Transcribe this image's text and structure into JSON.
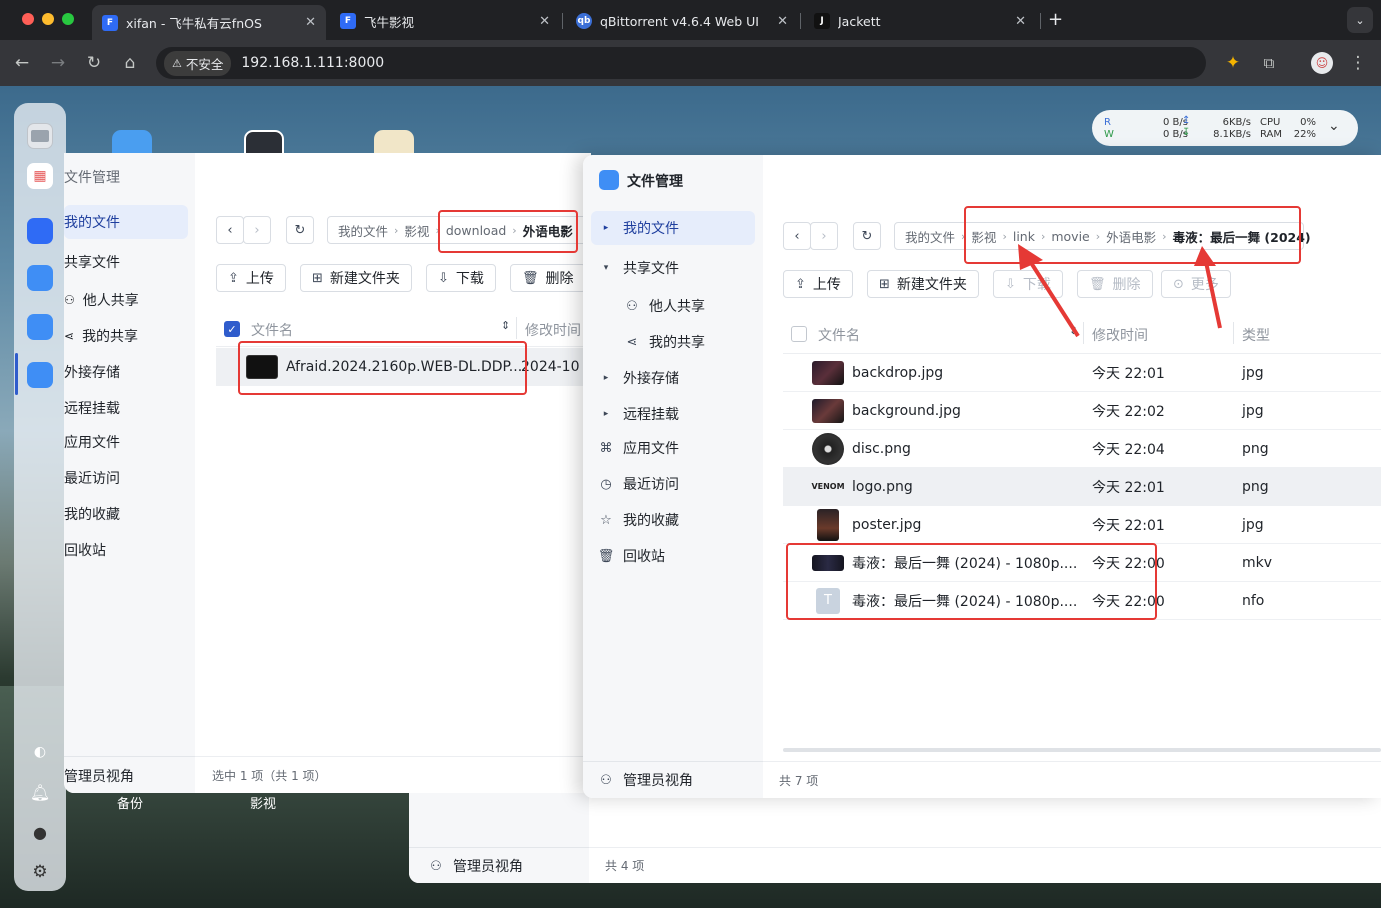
{
  "browser": {
    "tabs": [
      {
        "title": "xifan - 飞牛私有云fnOS",
        "icon": "fnos-icon"
      },
      {
        "title": "飞牛影视",
        "icon": "fnos-icon"
      },
      {
        "title": "qBittorrent v4.6.4 Web UI",
        "icon": "qbittorrent-icon"
      },
      {
        "title": "Jackett",
        "icon": "jackett-icon"
      }
    ],
    "security_label": "不安全",
    "url": "192.168.1.111:8000"
  },
  "desktop": {
    "icon_labels": [
      "备份",
      "影视"
    ]
  },
  "stats": {
    "r_label": "R",
    "w_label": "W",
    "r_speed": "0 B/s",
    "w_speed": "0 B/s",
    "r_rate": "6KB/s",
    "w_rate": "8.1KB/s",
    "cpu_label": "CPU",
    "ram_label": "RAM",
    "cpu": "0%",
    "ram": "22%"
  },
  "back_window": {
    "title": "文件管理",
    "nav": [
      "我的文件",
      "共享文件",
      "他人共享",
      "我的共享",
      "外接存储",
      "远程挂载",
      "应用文件",
      "最近访问",
      "我的收藏",
      "回收站"
    ],
    "admin_label": "管理员视角",
    "breadcrumb": [
      "我的文件",
      "影视",
      "download",
      "外语电影"
    ],
    "buttons": {
      "upload": "上传",
      "new_folder": "新建文件夹",
      "download": "下载",
      "delete": "删除"
    },
    "col_name": "文件名",
    "col_modified": "修改时间",
    "files": [
      {
        "name": "Afraid.2024.2160p.WEB-DL.DDP...",
        "modified": "2024-10"
      }
    ],
    "footer": "选中 1 项（共 1 项）"
  },
  "bottom_window": {
    "admin_label": "管理员视角",
    "footer": "共 4 项"
  },
  "front_window": {
    "title": "文件管理",
    "nav": [
      "我的文件",
      "共享文件",
      "他人共享",
      "我的共享",
      "外接存储",
      "远程挂载",
      "应用文件",
      "最近访问",
      "我的收藏",
      "回收站"
    ],
    "admin_label": "管理员视角",
    "breadcrumb": [
      "我的文件",
      "影视",
      "link",
      "movie",
      "外语电影",
      "毒液：最后一舞 (2024)"
    ],
    "buttons": {
      "upload": "上传",
      "new_folder": "新建文件夹",
      "download": "下载",
      "delete": "删除",
      "more": "更多"
    },
    "col_name": "文件名",
    "col_modified": "修改时间",
    "col_type": "类型",
    "files": [
      {
        "name": "backdrop.jpg",
        "modified": "今天 22:01",
        "type": "jpg"
      },
      {
        "name": "background.jpg",
        "modified": "今天 22:02",
        "type": "jpg"
      },
      {
        "name": "disc.png",
        "modified": "今天 22:04",
        "type": "png"
      },
      {
        "name": "logo.png",
        "modified": "今天 22:01",
        "type": "png",
        "thumb_text": "VENOM"
      },
      {
        "name": "poster.jpg",
        "modified": "今天 22:01",
        "type": "jpg"
      },
      {
        "name": "毒液：最后一舞 (2024) - 1080p....",
        "modified": "今天 22:00",
        "type": "mkv"
      },
      {
        "name": "毒液：最后一舞 (2024) - 1080p....",
        "modified": "今天 22:00",
        "type": "nfo",
        "thumb_text": "T"
      }
    ],
    "footer": "共 7 项"
  },
  "colors": {
    "accent": "#2f5ccc",
    "annotation": "#e53935",
    "selected_row": "#eef0f3"
  }
}
